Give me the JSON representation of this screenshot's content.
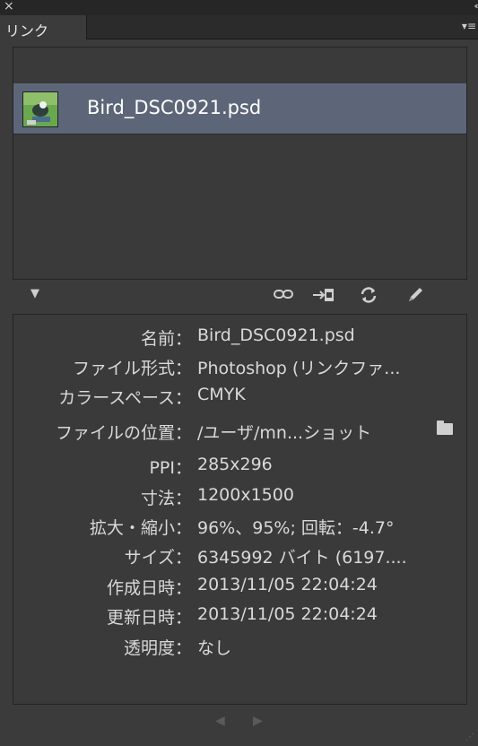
{
  "window": {
    "close_icon": "×",
    "collapse_icon": "‹‹"
  },
  "tabs": [
    {
      "label": "リンク"
    }
  ],
  "panel_menu_icon": "▾≡",
  "links": [
    {
      "filename": "Bird_DSC0921.psd"
    }
  ],
  "toolbar": {
    "toggle_icon": "▼",
    "relink_icon": "link-icon",
    "goto_link_icon": "goto-link-icon",
    "update_icon": "refresh-icon",
    "edit_icon": "pencil-icon"
  },
  "info": [
    {
      "label": "名前：",
      "value": "Bird_DSC0921.psd"
    },
    {
      "label": "ファイル形式：",
      "value": "Photoshop (リンクファ..."
    },
    {
      "label": "カラースペース：",
      "value": "CMYK"
    },
    {
      "label": "ファイルの位置：",
      "value": "/ユーザ/mn...ショット"
    },
    {
      "label": "PPI：",
      "value": "285x296"
    },
    {
      "label": "寸法：",
      "value": "1200x1500"
    },
    {
      "label": "拡大・縮小：",
      "value": "96%、95%; 回転：-4.7°"
    },
    {
      "label": "サイズ：",
      "value": "6345992 バイト (6197...."
    },
    {
      "label": "作成日時：",
      "value": "2013/11/05 22:04:24"
    },
    {
      "label": "更新日時：",
      "value": "2013/11/05 22:04:24"
    },
    {
      "label": "透明度：",
      "value": "なし"
    }
  ],
  "nav": {
    "prev_icon": "◀",
    "next_icon": "▶"
  },
  "colors": {
    "panel_bg": "#3b3b3b",
    "selected_row": "#5d6679",
    "text": "#d9d9d9"
  }
}
